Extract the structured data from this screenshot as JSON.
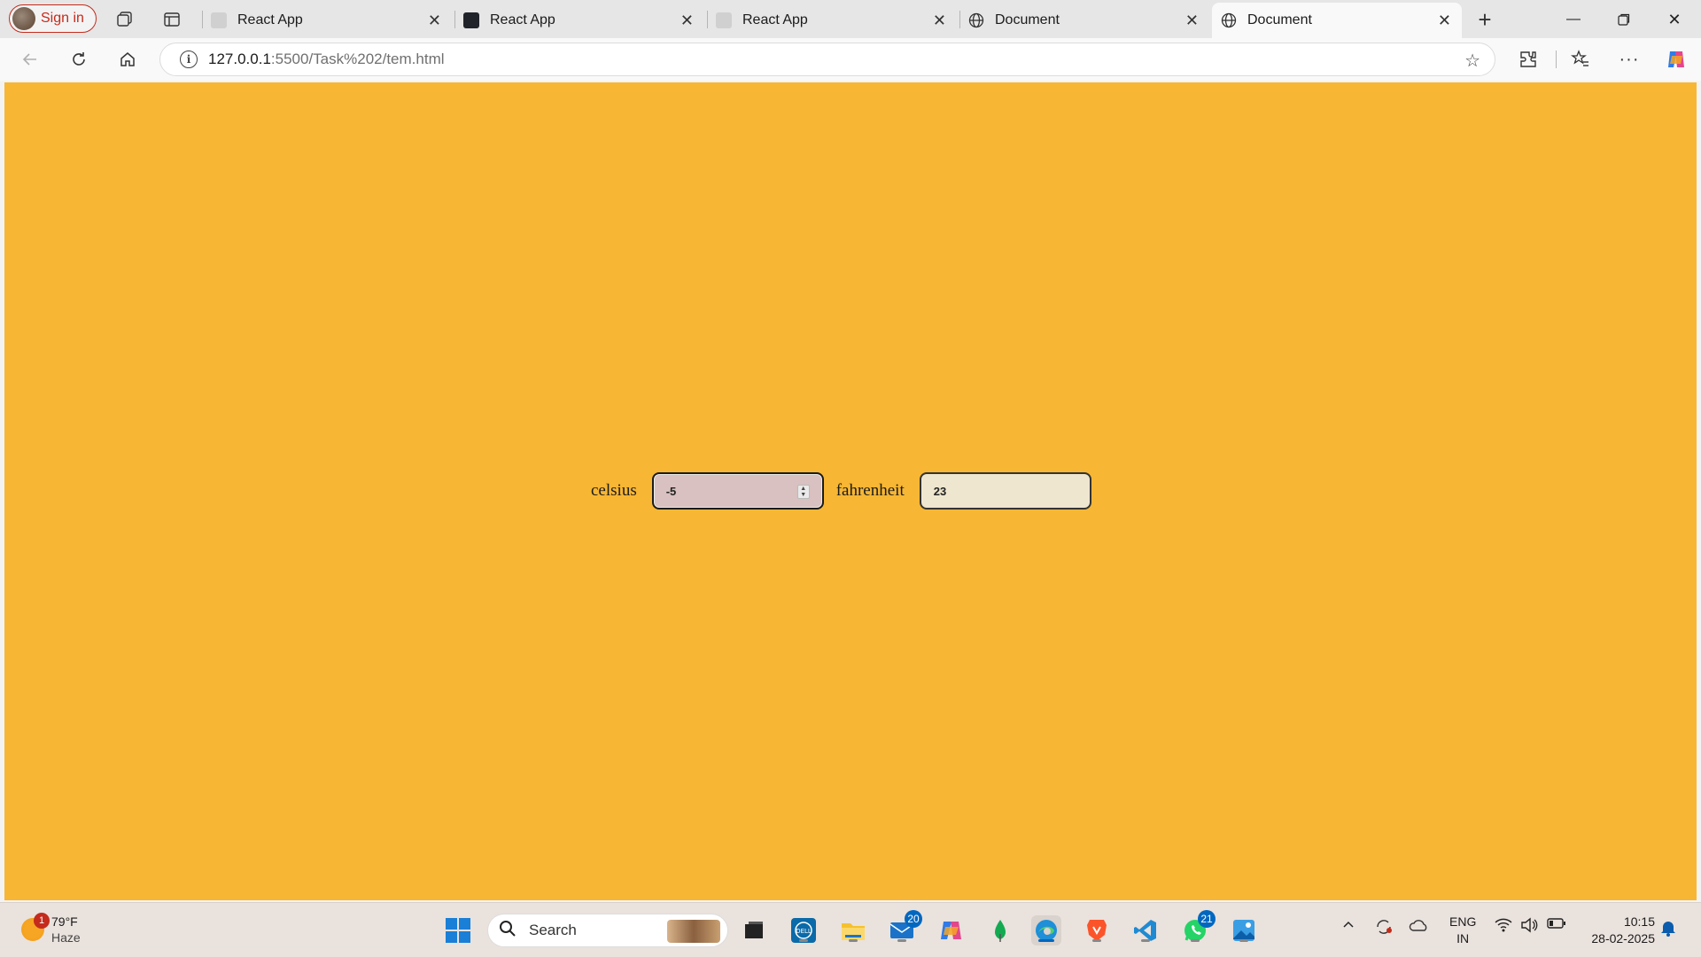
{
  "browser": {
    "signin_label": "Sign in",
    "tabs": [
      {
        "title": "React App",
        "favicon": "react-icon"
      },
      {
        "title": "React App",
        "favicon": "react-icon"
      },
      {
        "title": "React App",
        "favicon": "react-icon"
      },
      {
        "title": "Document",
        "favicon": "globe-icon"
      },
      {
        "title": "Document",
        "favicon": "globe-icon",
        "active": true
      }
    ],
    "url_host": "127.0.0.1",
    "url_path": ":5500/Task%202/tem.html"
  },
  "page": {
    "background": "#f7b633",
    "celsius_label": "celsius",
    "celsius_value": "-5",
    "fahrenheit_label": "fahrenheit",
    "fahrenheit_value": "23"
  },
  "taskbar": {
    "weather_temp": "79°F",
    "weather_desc": "Haze",
    "weather_badge": "1",
    "search_label": "Search",
    "mail_badge": "20",
    "whatsapp_badge": "21",
    "lang_top": "ENG",
    "lang_bottom": "IN",
    "time": "10:15",
    "date": "28-02-2025"
  }
}
